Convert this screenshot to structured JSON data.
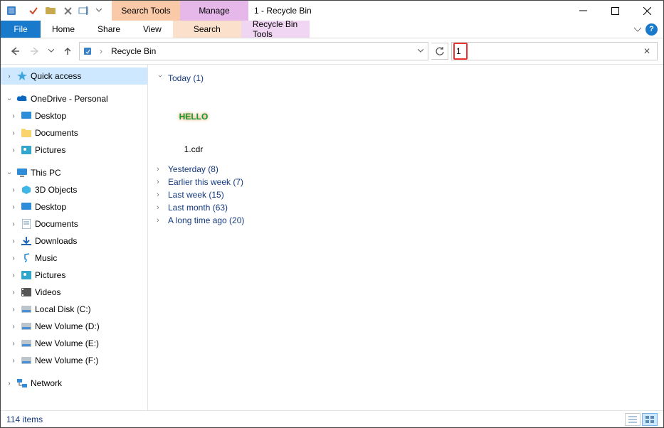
{
  "window": {
    "title": "1 - Recycle Bin"
  },
  "context_tabs": {
    "search": "Search Tools",
    "manage": "Manage"
  },
  "ribbon": {
    "file": "File",
    "tabs": [
      "Home",
      "Share",
      "View"
    ],
    "ctx": [
      "Search",
      "Recycle Bin Tools"
    ]
  },
  "address": {
    "location": "Recycle Bin",
    "sep": "›"
  },
  "search": {
    "value": "1",
    "clear": "✕"
  },
  "sidebar": {
    "quick_access": "Quick access",
    "onedrive": "OneDrive - Personal",
    "od_items": [
      "Desktop",
      "Documents",
      "Pictures"
    ],
    "this_pc": "This PC",
    "pc_items": [
      "3D Objects",
      "Desktop",
      "Documents",
      "Downloads",
      "Music",
      "Pictures",
      "Videos",
      "Local Disk (C:)",
      "New Volume (D:)",
      "New Volume (E:)",
      "New Volume (F:)"
    ],
    "network": "Network"
  },
  "content": {
    "groups": {
      "today": "Today (1)",
      "yesterday": "Yesterday (8)",
      "earlier_week": "Earlier this week (7)",
      "last_week": "Last week (15)",
      "last_month": "Last month (63)",
      "long_ago": "A long time ago (20)"
    },
    "file1": {
      "name": "1.cdr",
      "preview_text": "HELLO"
    }
  },
  "status": {
    "count": "114 items"
  }
}
